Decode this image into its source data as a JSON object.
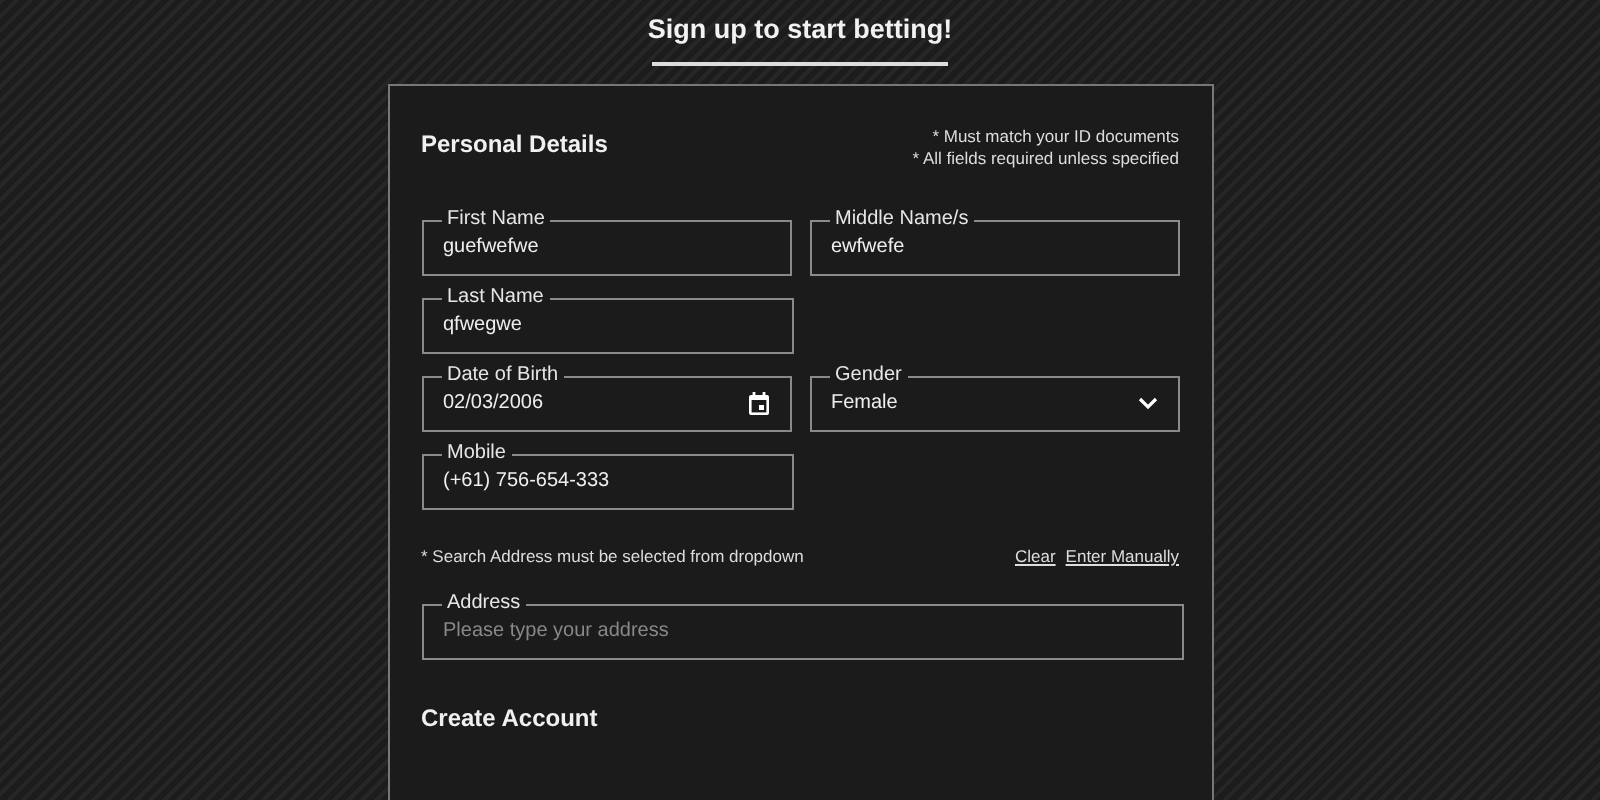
{
  "title": "Sign up to start betting!",
  "section": {
    "title": "Personal Details",
    "notes": [
      "* Must match your ID documents",
      "* All fields required unless specified"
    ]
  },
  "field_rows": [
    [
      {
        "kind": "text",
        "label": "First Name",
        "value": "guefwefwe"
      },
      {
        "kind": "text",
        "label": "Middle Name/s",
        "value": "ewfwefe"
      }
    ],
    [
      {
        "kind": "text",
        "label": "Last Name",
        "value": "qfwegwe"
      }
    ],
    [
      {
        "kind": "date",
        "label": "Date of Birth",
        "value": "02/03/2006"
      },
      {
        "kind": "select",
        "label": "Gender",
        "value": "Female"
      }
    ],
    [
      {
        "kind": "text",
        "label": "Mobile",
        "value": "(+61) 756-654-333"
      }
    ]
  ],
  "address": {
    "note": "* Search Address must be selected from dropdown",
    "links": [
      "Clear",
      "Enter Manually"
    ],
    "label": "Address",
    "placeholder": "Please type your address"
  },
  "next_section": {
    "title": "Create Account"
  }
}
